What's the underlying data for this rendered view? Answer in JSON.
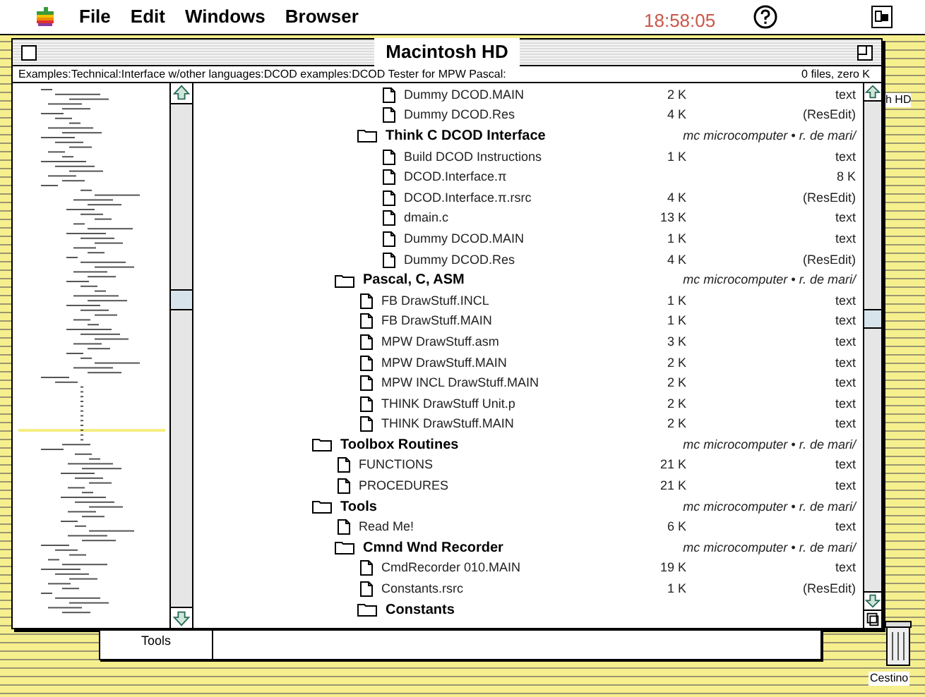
{
  "menu_bar": {
    "items": [
      "File",
      "Edit",
      "Windows",
      "Browser"
    ],
    "clock": "18:58:05"
  },
  "window": {
    "title": "Macintosh HD",
    "path": "Examples:Technical:Interface w/other languages:DCOD examples:DCOD Tester for MPW Pascal:",
    "summary": "0 files, zero K"
  },
  "list": [
    {
      "kind": "continued",
      "children": [
        {
          "kind": "continued",
          "children": [
            {
              "kind": "continued",
              "children": [
                {
                  "kind": "file",
                  "name": "Dummy DCOD.MAIN",
                  "size": "2 K",
                  "type": "text"
                },
                {
                  "kind": "file",
                  "name": "Dummy DCOD.Res",
                  "size": "4 K",
                  "type": "(ResEdit)"
                }
              ]
            },
            {
              "kind": "folder",
              "name": "Think C DCOD Interface",
              "owner": "mc microcomputer • r. de mari/",
              "children": [
                {
                  "kind": "file",
                  "name": "Build DCOD Instructions",
                  "size": "1 K",
                  "type": "text"
                },
                {
                  "kind": "file",
                  "name": "DCOD.Interface.π",
                  "type": "8 K"
                },
                {
                  "kind": "file",
                  "name": "DCOD.Interface.π.rsrc",
                  "size": "4 K",
                  "type": "(ResEdit)"
                },
                {
                  "kind": "file",
                  "name": "dmain.c",
                  "size": "13 K",
                  "type": "text"
                },
                {
                  "kind": "file",
                  "name": "Dummy DCOD.MAIN",
                  "size": "1 K",
                  "type": "text"
                },
                {
                  "kind": "file",
                  "name": "Dummy DCOD.Res",
                  "size": "4 K",
                  "type": "(ResEdit)"
                }
              ]
            }
          ]
        },
        {
          "kind": "folder",
          "name": "Pascal, C, ASM",
          "owner": "mc microcomputer • r. de mari/",
          "children": [
            {
              "kind": "file",
              "name": "FB DrawStuff.INCL",
              "size": "1 K",
              "type": "text"
            },
            {
              "kind": "file",
              "name": "FB DrawStuff.MAIN",
              "size": "1 K",
              "type": "text"
            },
            {
              "kind": "file",
              "name": "MPW DrawStuff.asm",
              "size": "3 K",
              "type": "text"
            },
            {
              "kind": "file",
              "name": "MPW DrawStuff.MAIN",
              "size": "2 K",
              "type": "text"
            },
            {
              "kind": "file",
              "name": "MPW INCL DrawStuff.MAIN",
              "size": "2 K",
              "type": "text"
            },
            {
              "kind": "file",
              "name": "THINK DrawStuff Unit.p",
              "size": "2 K",
              "type": "text"
            },
            {
              "kind": "file",
              "name": "THINK DrawStuff.MAIN",
              "size": "2 K",
              "type": "text"
            }
          ]
        }
      ]
    },
    {
      "kind": "folder",
      "name": "Toolbox Routines",
      "owner": "mc microcomputer • r. de mari/",
      "children": [
        {
          "kind": "file",
          "name": "FUNCTIONS",
          "size": "21 K",
          "type": "text"
        },
        {
          "kind": "file",
          "name": "PROCEDURES",
          "size": "21 K",
          "type": "text"
        }
      ]
    },
    {
      "kind": "folder",
      "name": "Tools",
      "owner": "mc microcomputer • r. de mari/",
      "children": [
        {
          "kind": "file",
          "name": "Read Me!",
          "size": "6 K",
          "type": "text"
        },
        {
          "kind": "folder",
          "name": "Cmnd Wnd Recorder",
          "owner": "mc microcomputer • r. de mari/",
          "children": [
            {
              "kind": "file",
              "name": "CmdRecorder 010.MAIN",
              "size": "19 K",
              "type": "text"
            },
            {
              "kind": "file",
              "name": "Constants.rsrc",
              "size": "1 K",
              "type": "(ResEdit)"
            },
            {
              "kind": "folder",
              "name": "Constants"
            }
          ]
        }
      ]
    }
  ],
  "tab_bar": {
    "label": "Tools"
  },
  "desktop": {
    "disk_label": "h HD",
    "trash_label": "Cestino"
  }
}
